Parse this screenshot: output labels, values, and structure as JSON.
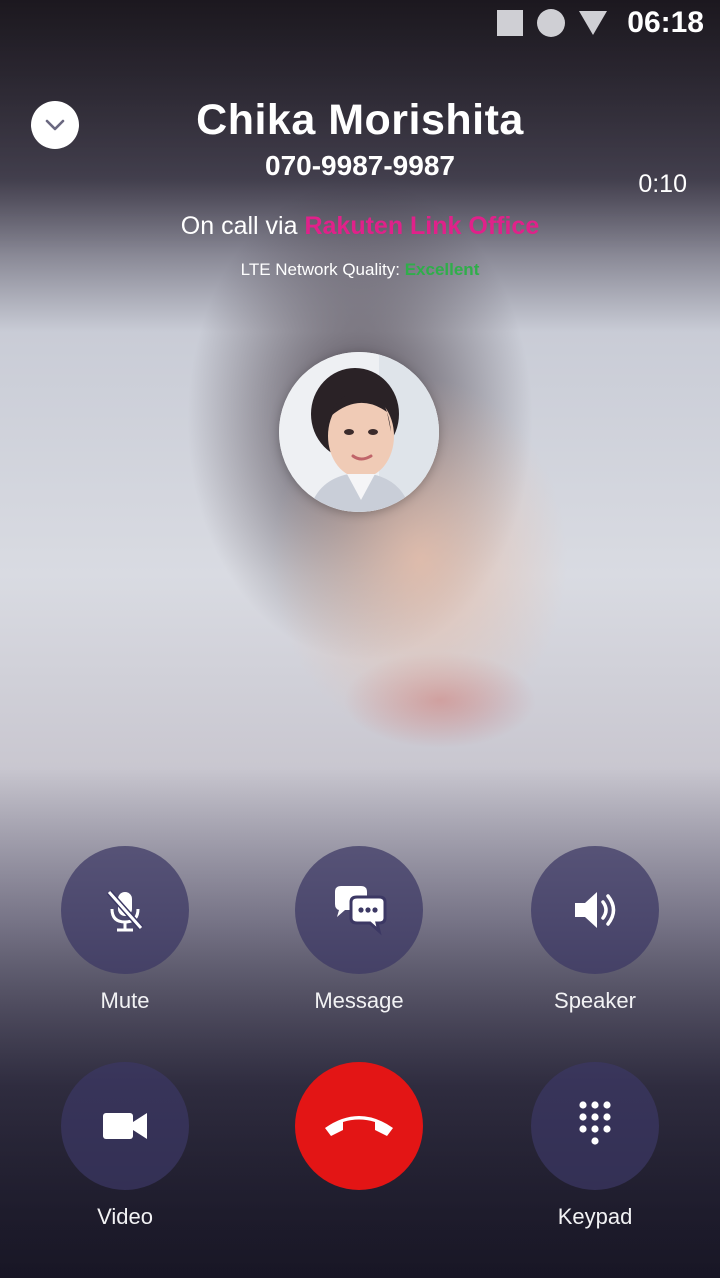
{
  "status_bar": {
    "time": "06:18"
  },
  "caller": {
    "name": "Chika Morishita",
    "number": "070-9987-9987"
  },
  "call": {
    "duration": "0:10",
    "via_prefix": "On call via ",
    "via_service": "Rakuten Link Office",
    "network_label": "LTE Network Quality: ",
    "network_value": "Excellent"
  },
  "controls": {
    "mute": "Mute",
    "message": "Message",
    "speaker": "Speaker",
    "video": "Video",
    "keypad": "Keypad"
  },
  "colors": {
    "brand": "#e0218a",
    "quality_good": "#2fae4a",
    "end_call": "#e31515",
    "control_bg": "#3c3864"
  },
  "icons": [
    "chevron-down-icon",
    "mic-off-icon",
    "chat-bubbles-icon",
    "speaker-icon",
    "video-camera-icon",
    "keypad-icon",
    "end-call-icon"
  ]
}
